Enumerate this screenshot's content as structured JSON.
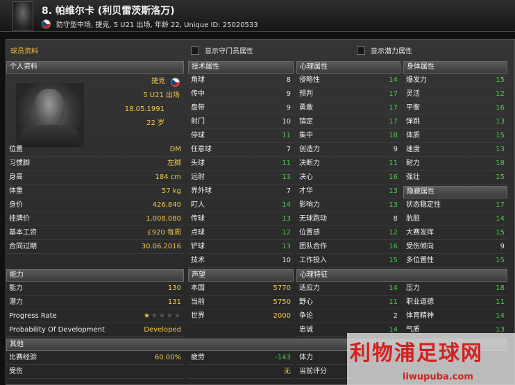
{
  "header": {
    "title": "8. 帕维尔卡 (利贝雷茨斯洛万)",
    "subtitle": "防守型中场, 捷克, 5 U21 出场, 年龄 22, Unique ID: 25020533"
  },
  "panel": {
    "title": "球员资料",
    "checkbox_goalkeeper": "显示守门员属性",
    "checkbox_potential": "显示潜力属性"
  },
  "personal": {
    "header": "个人资料",
    "nation": "捷克",
    "u21": "5 U21 出场",
    "dob": "18.05.1991",
    "age": "22 岁",
    "rows": [
      {
        "label": "位置",
        "value": "DM"
      },
      {
        "label": "习惯脚",
        "value": "左脚"
      },
      {
        "label": "身高",
        "value": "184 cm"
      },
      {
        "label": "体重",
        "value": "57 kg"
      },
      {
        "label": "身价",
        "value": "426,840"
      },
      {
        "label": "挂牌价",
        "value": "1,008,080"
      },
      {
        "label": "基本工资",
        "value": "£920 每周"
      },
      {
        "label": "合同过期",
        "value": "30.06.2016"
      }
    ]
  },
  "technical": {
    "header": "技术属性",
    "rows": [
      {
        "label": "角球",
        "value": "8"
      },
      {
        "label": "传中",
        "value": "9"
      },
      {
        "label": "盘带",
        "value": "9"
      },
      {
        "label": "射门",
        "value": "10"
      },
      {
        "label": "停球",
        "value": "11"
      },
      {
        "label": "任意球",
        "value": "7"
      },
      {
        "label": "头球",
        "value": "11"
      },
      {
        "label": "远射",
        "value": "13"
      },
      {
        "label": "界外球",
        "value": "7"
      },
      {
        "label": "盯人",
        "value": "14"
      },
      {
        "label": "传球",
        "value": "13"
      },
      {
        "label": "点球",
        "value": "12"
      },
      {
        "label": "铲球",
        "value": "13"
      },
      {
        "label": "技术",
        "value": "10"
      }
    ]
  },
  "mental": {
    "header": "心理属性",
    "rows": [
      {
        "label": "侵略性",
        "value": "14"
      },
      {
        "label": "预判",
        "value": "17"
      },
      {
        "label": "勇敢",
        "value": "17"
      },
      {
        "label": "镇定",
        "value": "17"
      },
      {
        "label": "集中",
        "value": "18"
      },
      {
        "label": "创造力",
        "value": "9"
      },
      {
        "label": "决断力",
        "value": "11"
      },
      {
        "label": "决心",
        "value": "16"
      },
      {
        "label": "才华",
        "value": "13"
      },
      {
        "label": "影响力",
        "value": "13"
      },
      {
        "label": "无球跑动",
        "value": "8"
      },
      {
        "label": "位置感",
        "value": "12"
      },
      {
        "label": "团队合作",
        "value": "16"
      },
      {
        "label": "工作投入",
        "value": "15"
      }
    ]
  },
  "physical": {
    "header": "身体属性",
    "rows": [
      {
        "label": "爆发力",
        "value": "15"
      },
      {
        "label": "灵活",
        "value": "12"
      },
      {
        "label": "平衡",
        "value": "16"
      },
      {
        "label": "弹跳",
        "value": "13"
      },
      {
        "label": "体质",
        "value": "15"
      },
      {
        "label": "速度",
        "value": "13"
      },
      {
        "label": "耐力",
        "value": "18"
      },
      {
        "label": "强壮",
        "value": "15"
      }
    ]
  },
  "hidden": {
    "header": "隐藏属性",
    "rows": [
      {
        "label": "状态稳定性",
        "value": "17"
      },
      {
        "label": "肮脏",
        "value": "14"
      },
      {
        "label": "大赛发挥",
        "value": "15"
      },
      {
        "label": "受伤倾向",
        "value": "9"
      },
      {
        "label": "多位置性",
        "value": "15"
      }
    ]
  },
  "ability": {
    "header": "能力",
    "rows": [
      {
        "label": "能力",
        "value": "130"
      },
      {
        "label": "潜力",
        "value": "131"
      }
    ],
    "progress_label": "Progress Rate",
    "progress_stars": 0.5,
    "progress_max_stars": 5,
    "development_label": "Probability Of Development",
    "development_value": "Developed"
  },
  "reputation": {
    "header": "声望",
    "rows": [
      {
        "label": "本国",
        "value": "5770"
      },
      {
        "label": "当前",
        "value": "5750"
      },
      {
        "label": "世界",
        "value": "2000"
      }
    ]
  },
  "mental_traits": {
    "header": "心理特征",
    "rows": [
      {
        "label": "适应力",
        "value": "14"
      },
      {
        "label": "野心",
        "value": "11"
      },
      {
        "label": "争论",
        "value": "2"
      },
      {
        "label": "忠诚",
        "value": "14"
      }
    ],
    "rows_right": [
      {
        "label": "压力",
        "value": "18"
      },
      {
        "label": "职业道德",
        "value": "11"
      },
      {
        "label": "体育精神",
        "value": "14"
      },
      {
        "label": "气质",
        "value": "13"
      }
    ]
  },
  "other": {
    "header": "其他",
    "rows": [
      {
        "label": "比赛经验",
        "value": "60.00%"
      },
      {
        "label": "受伤",
        "value": ""
      }
    ],
    "fatigue_label": "疲劳",
    "fatigue_value": "-143",
    "status_value": "无",
    "fitness_label": "体力",
    "rating_label": "当前评分"
  },
  "watermark": {
    "title": "利物浦足球网",
    "url": "liwupuba.com"
  }
}
